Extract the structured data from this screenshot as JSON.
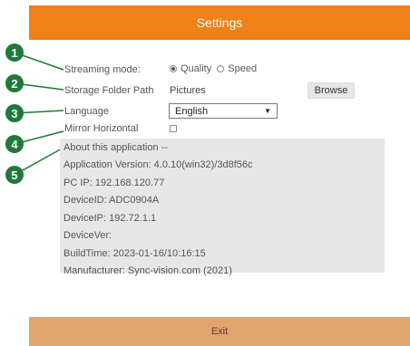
{
  "title": "Settings",
  "footer_label": "Exit",
  "fields": {
    "streaming_label": "Streaming mode:",
    "quality_label": "Quality",
    "speed_label": "Speed",
    "selected_mode": "Quality",
    "storage_label": "Storage Folder Path",
    "storage_value": "Pictures",
    "browse_label": "Browse",
    "language_label": "Language",
    "language_value": "English",
    "mirror_label": "Mirror Horizontal",
    "mirror_checked": false
  },
  "about": {
    "heading": "About this application --",
    "lines": [
      "Application Version: 4.0.10(win32)/3d8f56c",
      "PC IP: 192.168.120.77",
      "DeviceID: ADC0904A",
      "DeviceIP: 192.72.1.1",
      "DeviceVer:",
      "BuildTime: 2023-01-16/10:16:15",
      "Manufacturer: Sync-vision.com (2021)"
    ]
  },
  "callouts": [
    "1",
    "2",
    "3",
    "4",
    "5"
  ],
  "colors": {
    "accent": "#ee8118",
    "footer": "#e1a46c",
    "badge": "#1f7a3a",
    "about_bg": "#e7e7e7"
  }
}
